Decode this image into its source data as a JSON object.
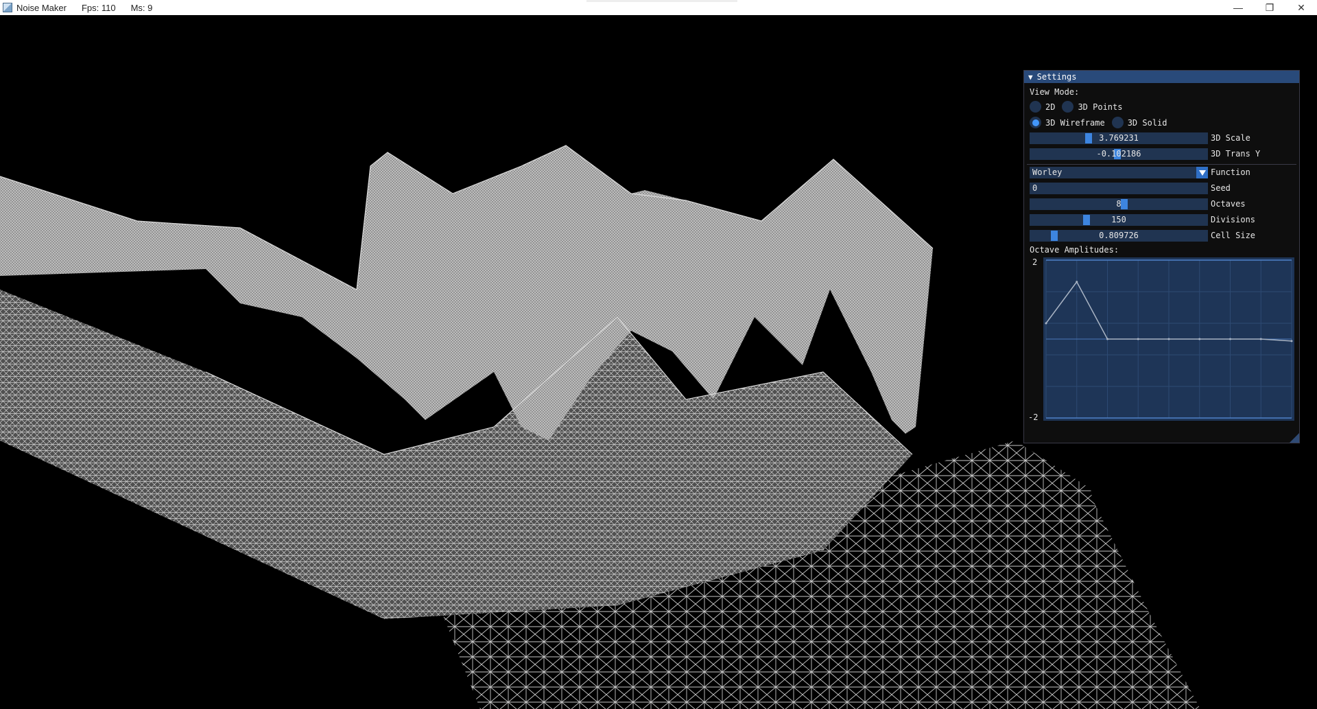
{
  "window": {
    "title": "Noise Maker",
    "fps": "Fps: 110",
    "ms": "Ms: 9",
    "buttons": {
      "minimize": "—",
      "restore": "❐",
      "close": "✕"
    }
  },
  "settings": {
    "header": "Settings",
    "view_mode_label": "View Mode:",
    "view_modes": [
      {
        "label": "2D",
        "selected": false
      },
      {
        "label": "3D Points",
        "selected": false
      },
      {
        "label": "3D Wireframe",
        "selected": true
      },
      {
        "label": "3D Solid",
        "selected": false
      }
    ],
    "scale_3d": {
      "value": "3.769231",
      "label": "3D Scale"
    },
    "trans_y_3d": {
      "value": "-0.102186",
      "label": "3D Trans Y"
    },
    "function": {
      "value": "Worley",
      "label": "Function"
    },
    "seed": {
      "value": "0",
      "label": "Seed"
    },
    "octaves": {
      "value": "8",
      "label": "Octaves"
    },
    "divisions": {
      "value": "150",
      "label": "Divisions"
    },
    "cell_size": {
      "value": "0.809726",
      "label": "Cell Size"
    },
    "octave_amplitudes_label": "Octave Amplitudes:",
    "colors": {
      "accent": "#4296fa",
      "frame_bg": "#203451",
      "header": "#294a7a"
    }
  },
  "chart_data": {
    "type": "line",
    "title": "Octave Amplitudes:",
    "ylim": [
      -2,
      2
    ],
    "y_tick_labels": [
      "2",
      "-2"
    ],
    "x": [
      0,
      1,
      2,
      3,
      4,
      5,
      6,
      7,
      8
    ],
    "series": [
      {
        "values": [
          0.4,
          1.45,
          0.0,
          0.0,
          0.0,
          0.0,
          0.0,
          0.0,
          -0.05
        ]
      }
    ],
    "grid": true
  }
}
